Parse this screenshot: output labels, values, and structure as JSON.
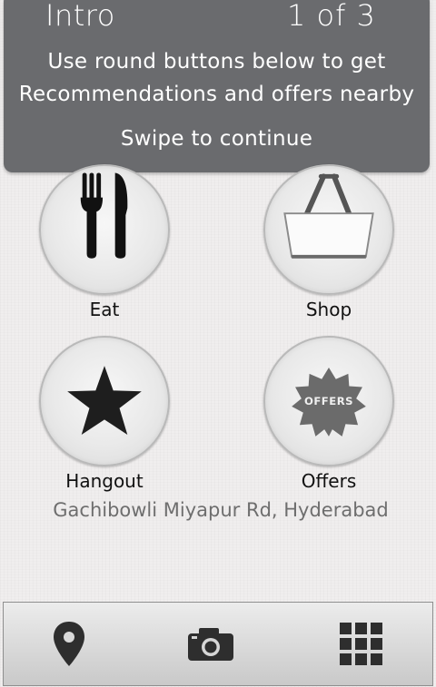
{
  "intro": {
    "title": "Intro",
    "counter": "1 of 3",
    "line1": "Use round buttons below to get",
    "line2": "Recommendations and offers nearby",
    "line3": "Swipe to continue"
  },
  "categories": [
    {
      "label": "Eat",
      "icon": "fork-knife-icon"
    },
    {
      "label": "Shop",
      "icon": "shopping-basket-icon"
    },
    {
      "label": "Hangout",
      "icon": "star-icon"
    },
    {
      "label": "Offers",
      "icon": "offers-badge-icon",
      "badge_text": "OFFERS"
    }
  ],
  "location": "Gachibowli Miyapur Rd, Hyderabad",
  "toolbar": {
    "items": [
      {
        "icon": "location-pin-icon"
      },
      {
        "icon": "camera-icon"
      },
      {
        "icon": "grid-menu-icon"
      }
    ]
  },
  "colors": {
    "intro_bg": "#6a6b6e",
    "icon_dark": "#111111",
    "location_text": "#6e6e6e",
    "toolbar_icon": "#2e2e2e"
  }
}
